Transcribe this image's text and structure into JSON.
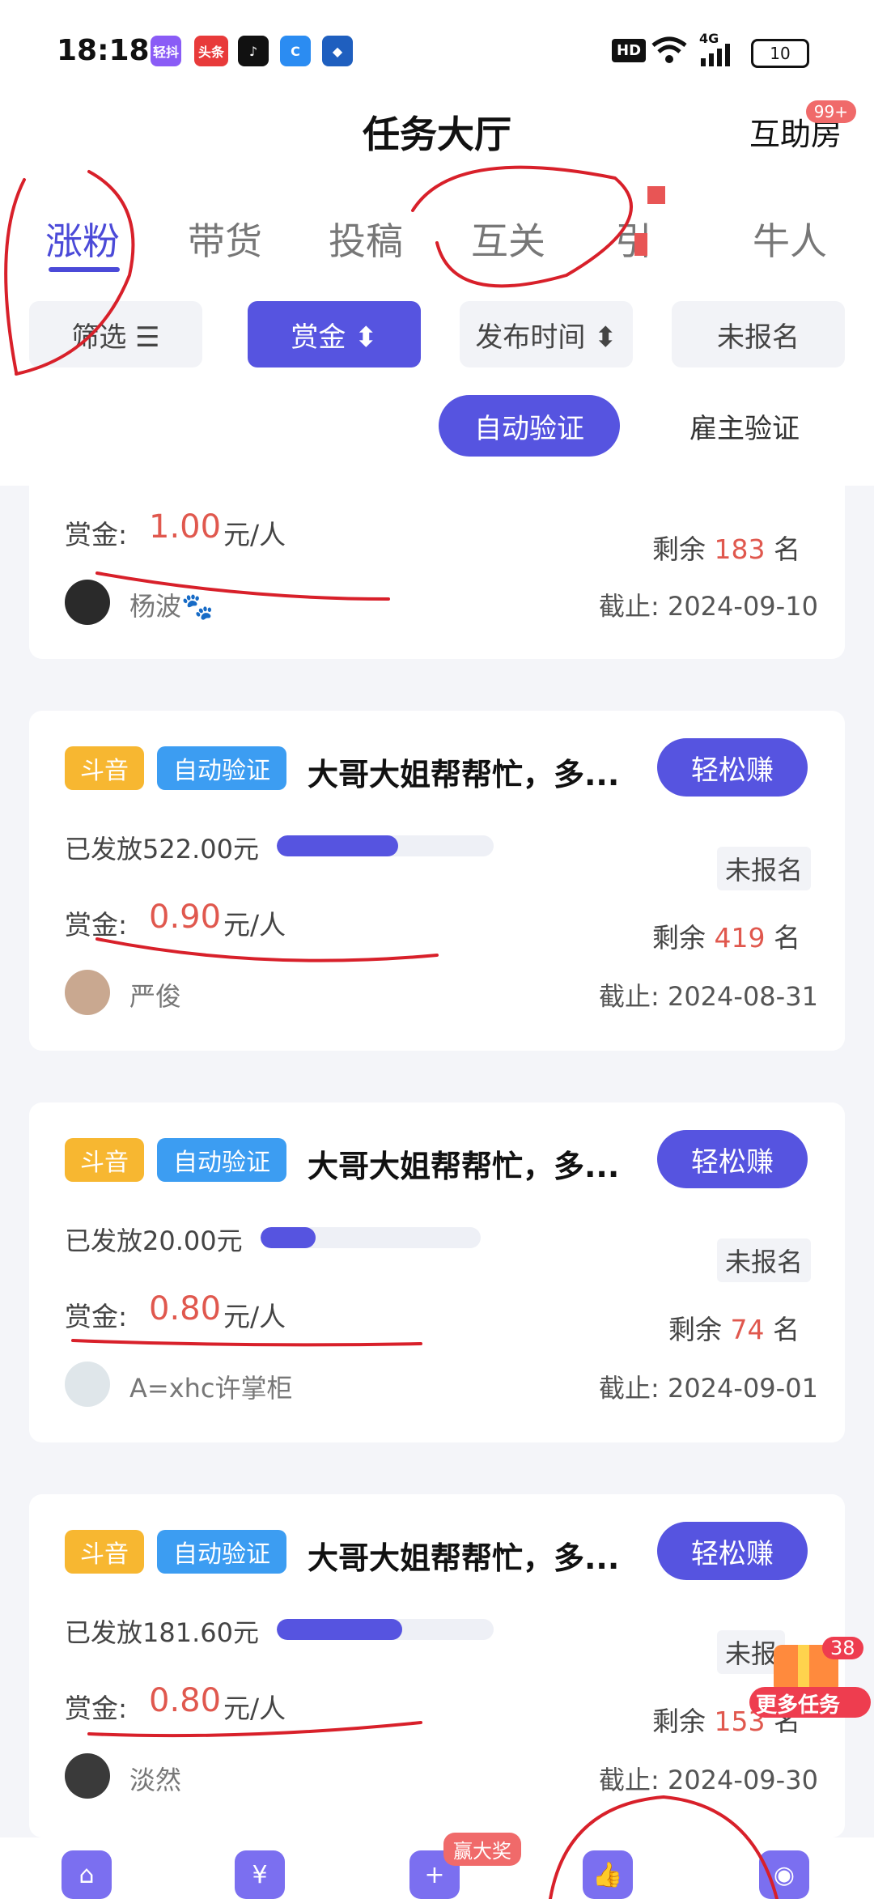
{
  "status_bar": {
    "time": "18:18",
    "apps": [
      {
        "name": "qingdou-icon",
        "label": "轻抖",
        "color": "#8a5cf6"
      },
      {
        "name": "toutiao-icon",
        "label": "头条",
        "color": "#e83a3a"
      },
      {
        "name": "tiktok-icon",
        "label": "♪",
        "color": "#111111"
      },
      {
        "name": "app-c-icon",
        "label": "C",
        "color": "#2b8cf2"
      },
      {
        "name": "app-shield-icon",
        "label": "◆",
        "color": "#1f5fbf"
      }
    ],
    "hd": "HD",
    "network": "4G",
    "battery": "10"
  },
  "header": {
    "title": "任务大厅",
    "helper_label": "互助房",
    "helper_badge": "99+"
  },
  "tabs": [
    {
      "label": "涨粉",
      "active": true
    },
    {
      "label": "带货",
      "active": false
    },
    {
      "label": "投稿",
      "active": false
    },
    {
      "label": "互关",
      "active": false
    },
    {
      "label": "引",
      "active": false
    },
    {
      "label": "牛人",
      "active": false
    }
  ],
  "filters": [
    {
      "label": "筛选 ☰",
      "active": false
    },
    {
      "label": "赏金 ⬍",
      "active": true
    },
    {
      "label": "发布时间 ⬍",
      "active": false
    },
    {
      "label": "未报名",
      "active": false
    }
  ],
  "verify_toggle": [
    {
      "label": "自动验证",
      "active": true
    },
    {
      "label": "雇主验证",
      "active": false
    }
  ],
  "partial_card": {
    "reward_label": "赏金:",
    "reward": "1.00",
    "unit": "元/人",
    "remain_prefix": "剩余",
    "remain": "183",
    "remain_suffix": "名",
    "user": "杨波🐾",
    "deadline": "截止: 2024-09-10"
  },
  "cards": [
    {
      "platform": "斗音",
      "verify": "自动验证",
      "title": "大哥大姐帮帮忙，多...",
      "button": "轻松赚",
      "issued": "已发放522.00元",
      "progress": 0.56,
      "status": "未报名",
      "reward_label": "赏金:",
      "reward": "0.90",
      "unit": "元/人",
      "remain_prefix": "剩余",
      "remain": "419",
      "remain_suffix": "名",
      "user": "严俊",
      "deadline": "截止: 2024-08-31"
    },
    {
      "platform": "斗音",
      "verify": "自动验证",
      "title": "大哥大姐帮帮忙，多...",
      "button": "轻松赚",
      "issued": "已发放20.00元",
      "progress": 0.25,
      "status": "未报名",
      "reward_label": "赏金:",
      "reward": "0.80",
      "unit": "元/人",
      "remain_prefix": "剩余",
      "remain": "74",
      "remain_suffix": "名",
      "user": "A=xhc许掌柜",
      "deadline": "截止: 2024-09-01"
    },
    {
      "platform": "斗音",
      "verify": "自动验证",
      "title": "大哥大姐帮帮忙，多...",
      "button": "轻松赚",
      "issued": "已发放181.60元",
      "progress": 0.58,
      "status": "未报",
      "reward_label": "赏金:",
      "reward": "0.80",
      "unit": "元/人",
      "remain_prefix": "剩余",
      "remain": "153",
      "remain_suffix": "名",
      "user": "淡然",
      "deadline": "截止: 2024-09-30"
    }
  ],
  "floating": {
    "label": "更多任务",
    "count": "38"
  },
  "bottom_nav": {
    "win_badge": "赢大奖"
  }
}
